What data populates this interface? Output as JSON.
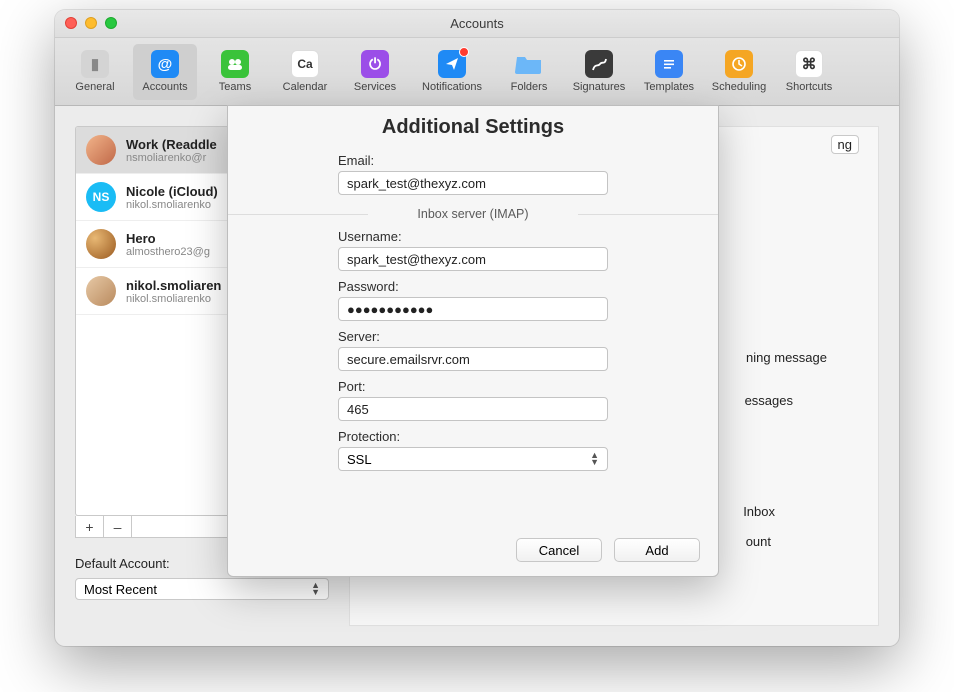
{
  "window": {
    "title": "Accounts"
  },
  "toolbar": {
    "items": [
      {
        "id": "general",
        "label": "General"
      },
      {
        "id": "accounts",
        "label": "Accounts"
      },
      {
        "id": "teams",
        "label": "Teams"
      },
      {
        "id": "calendar",
        "label": "Calendar",
        "badge_text": "Ca"
      },
      {
        "id": "services",
        "label": "Services"
      },
      {
        "id": "notifications",
        "label": "Notifications"
      },
      {
        "id": "folders",
        "label": "Folders"
      },
      {
        "id": "signatures",
        "label": "Signatures"
      },
      {
        "id": "templates",
        "label": "Templates"
      },
      {
        "id": "scheduling",
        "label": "Scheduling"
      },
      {
        "id": "shortcuts",
        "label": "Shortcuts"
      }
    ]
  },
  "accounts": [
    {
      "title": "Work (Readdle",
      "sub": "nsmoliarenko@r",
      "avatar_bg": "#e8a37a"
    },
    {
      "title": "Nicole (iCloud)",
      "sub": "nikol.smoliarenko",
      "avatar_bg": "#1abcf5",
      "initials": "NS"
    },
    {
      "title": "Hero",
      "sub": "almosthero23@g",
      "avatar_bg": "#c98b3a"
    },
    {
      "title": "nikol.smoliaren",
      "sub": "nikol.smoliarenko",
      "avatar_bg": "#d8b28a"
    }
  ],
  "footer_buttons": {
    "add": "+",
    "remove": "–"
  },
  "default_account": {
    "label": "Default Account:",
    "value": "Most Recent"
  },
  "right_peek": {
    "r1": "ng",
    "r2": "ning message",
    "r3": "essages",
    "r4": "Inbox",
    "r5": "ount"
  },
  "dialog": {
    "title": "Additional Settings",
    "email_label": "Email:",
    "email_value": "spark_test@thexyz.com",
    "section": "Inbox server (IMAP)",
    "username_label": "Username:",
    "username_value": "spark_test@thexyz.com",
    "password_label": "Password:",
    "password_value": "●●●●●●●●●●●",
    "server_label": "Server:",
    "server_value": "secure.emailsrvr.com",
    "port_label": "Port:",
    "port_value": "465",
    "protection_label": "Protection:",
    "protection_value": "SSL",
    "cancel": "Cancel",
    "add": "Add"
  }
}
